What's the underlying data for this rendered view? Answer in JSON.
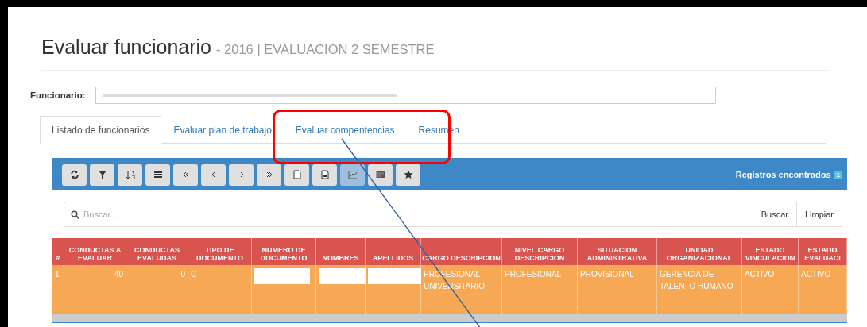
{
  "header": {
    "title": "Evaluar funcionario",
    "subtitle": "- 2016 | EVALUACION 2 SEMESTRE"
  },
  "funcionario": {
    "label": "Funcionario:"
  },
  "tabs": [
    {
      "label": "Listado de funcionarios",
      "selected": true
    },
    {
      "label": "Evaluar plan de trabajo",
      "selected": false
    },
    {
      "label": "Evaluar compentencias",
      "selected": false
    },
    {
      "label": "Resumen",
      "selected": false
    }
  ],
  "toolbar": [
    {
      "kind": "refresh",
      "disabled": false
    },
    {
      "kind": "filter",
      "disabled": false
    },
    {
      "kind": "sort",
      "disabled": false
    },
    {
      "kind": "list",
      "disabled": false
    },
    {
      "kind": "first",
      "disabled": false
    },
    {
      "kind": "prev",
      "disabled": false
    },
    {
      "kind": "next",
      "disabled": false
    },
    {
      "kind": "last",
      "disabled": false
    },
    {
      "kind": "file",
      "disabled": false
    },
    {
      "kind": "file2",
      "disabled": false
    },
    {
      "kind": "chart",
      "disabled": true
    },
    {
      "kind": "card",
      "disabled": false
    },
    {
      "kind": "star",
      "disabled": false
    }
  ],
  "records": {
    "label": "Registros encontrados",
    "count": "1"
  },
  "search": {
    "placeholder": "Buscar...",
    "buttons": [
      "Buscar",
      "Limpiar"
    ]
  },
  "table": {
    "columns": [
      "#",
      "CONDUCTAS A EVALUAR",
      "CONDUCTAS EVALUDAS",
      "TIPO DE DOCUMENTO",
      "NUMERO DE DOCUMENTO",
      "NOMBRES",
      "APELLIDOS",
      "CARGO DESCRIPCION",
      "NIVEL CARGO DESCRIPCION",
      "SITUACION ADMINISTRATIVA",
      "UNIDAD ORGANIZACIONAL",
      "ESTADO VINCULACION",
      "ESTADO EVALUACI"
    ],
    "rows": [
      {
        "cells": [
          {
            "text": "1",
            "redacted": false
          },
          {
            "text": "40",
            "redacted": false
          },
          {
            "text": "0",
            "redacted": false
          },
          {
            "text": "C",
            "redacted": false
          },
          {
            "redacted": true
          },
          {
            "redacted": true
          },
          {
            "redacted": true
          },
          {
            "text": "PROFESIONAL UNIVERSITARIO",
            "redacted": false
          },
          {
            "text": "PROFESIONAL",
            "redacted": false
          },
          {
            "text": "PROVISIONAL",
            "redacted": false
          },
          {
            "text": "GERENCIA DE TALENTO HUMANO",
            "redacted": false
          },
          {
            "text": "ACTIVO",
            "redacted": false
          },
          {
            "text": "ACTIVO",
            "redacted": false
          }
        ]
      }
    ]
  },
  "annotations": [
    {
      "kind": "box"
    },
    {
      "kind": "line"
    }
  ]
}
